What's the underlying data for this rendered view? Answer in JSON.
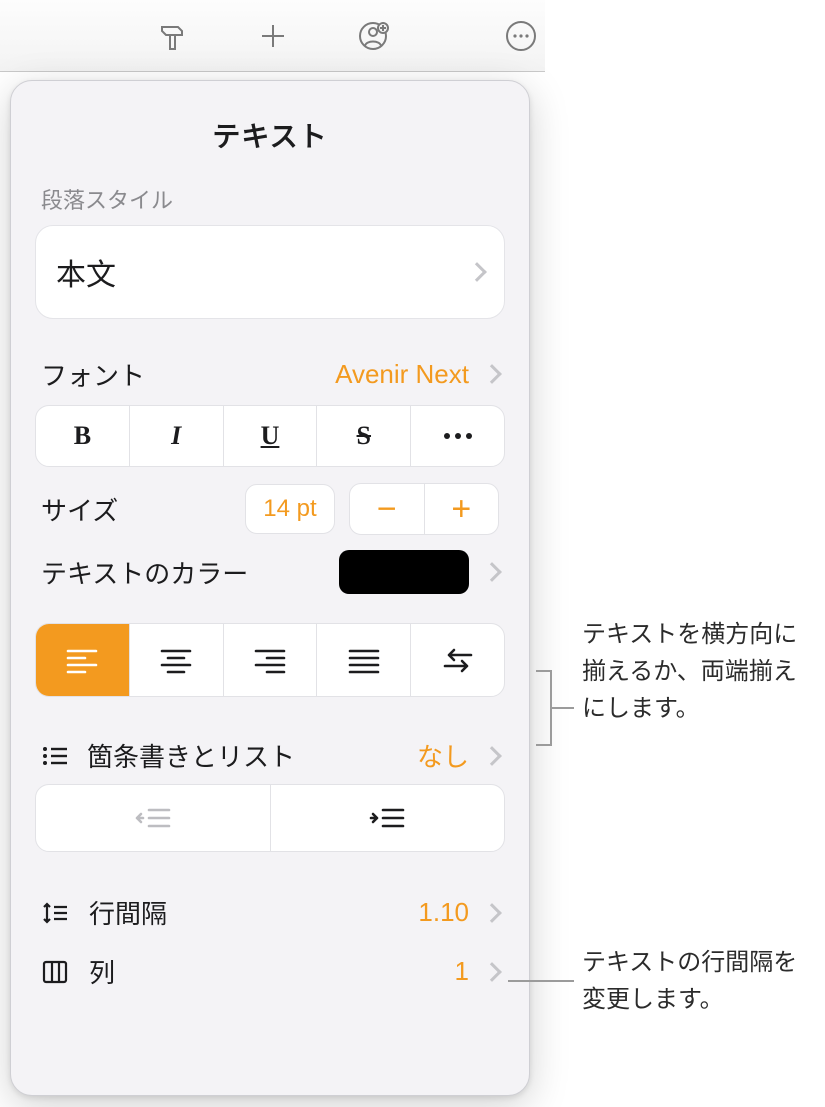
{
  "toolbar": {
    "format_icon": "format-brush-icon",
    "add_icon": "plus-icon",
    "collab_icon": "person-add-icon",
    "more_icon": "ellipsis-circle-icon"
  },
  "popover": {
    "title": "テキスト",
    "paragraph_style_label": "段落スタイル",
    "paragraph_style_value": "本文",
    "font_label": "フォント",
    "font_value": "Avenir Next",
    "style_buttons": {
      "bold": "B",
      "italic": "I",
      "underline": "U",
      "strike": "S"
    },
    "size_label": "サイズ",
    "size_value": "14 pt",
    "text_color_label": "テキストのカラー",
    "text_color_value": "#000000",
    "alignment_active": "left",
    "bullets_label": "箇条書きとリスト",
    "bullets_value": "なし",
    "line_spacing_label": "行間隔",
    "line_spacing_value": "1.10",
    "columns_label": "列",
    "columns_value": "1"
  },
  "callouts": {
    "alignment": "テキストを横方向に揃えるか、両端揃えにします。",
    "line_spacing": "テキストの行間隔を変更します。"
  },
  "colors": {
    "accent": "#f39a1f"
  }
}
